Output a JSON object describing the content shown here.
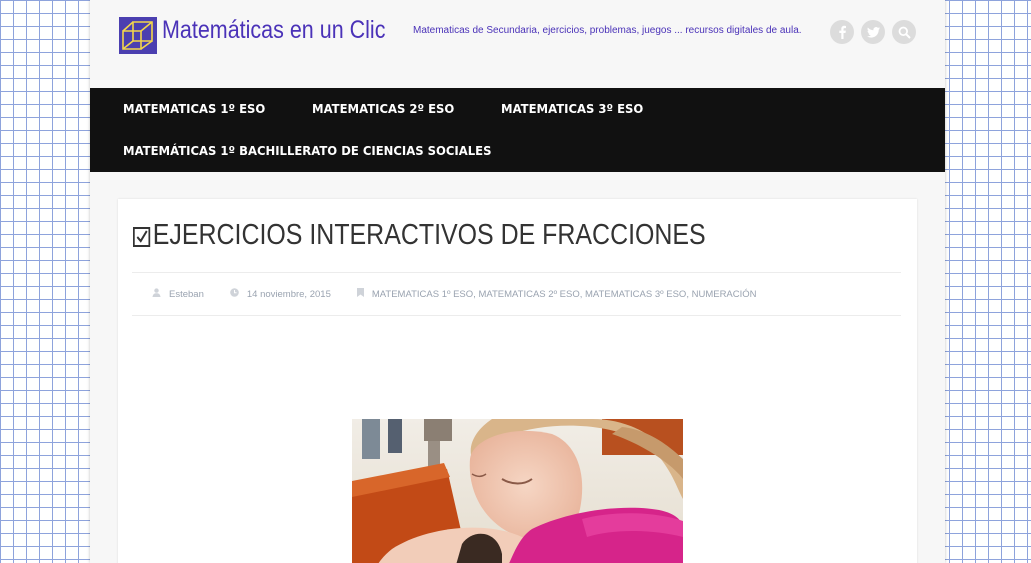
{
  "header": {
    "site_title": "Matemáticas en un Clic",
    "tagline": "Matematicas de Secundaria, ejercicios, problemas, juegos ... recursos digitales de aula.",
    "social_icons": [
      "facebook-icon",
      "twitter-icon",
      "search-icon"
    ]
  },
  "nav": {
    "items": [
      {
        "label": "MATEMATICAS 1º ESO"
      },
      {
        "label": "MATEMATICAS 2º ESO"
      },
      {
        "label": "MATEMATICAS 3º ESO"
      },
      {
        "label": "MATEMÁTICAS 1º BACHILLERATO DE CIENCIAS SOCIALES"
      }
    ]
  },
  "post": {
    "title": "EJERCICIOS INTERACTIVOS DE FRACCIONES",
    "author": "Esteban",
    "date": "14 noviembre, 2015",
    "categories": "MATEMATICAS 1º ESO, MATEMATICAS 2º ESO, MATEMATICAS 3º ESO, NUMERACIÓN"
  },
  "colors": {
    "brand": "#4a32b8",
    "nav_bg": "#111111",
    "grid_lines": "#8ea3dc"
  }
}
